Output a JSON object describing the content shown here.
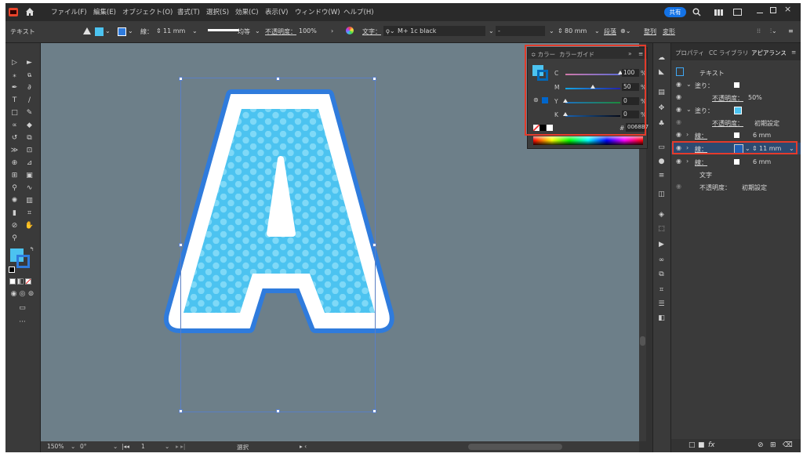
{
  "menubar": {
    "items": [
      "ファイル(F)",
      "編集(E)",
      "オブジェクト(O)",
      "書式(T)",
      "選択(S)",
      "効果(C)",
      "表示(V)",
      "ウィンドウ(W)",
      "ヘルプ(H)"
    ],
    "share_label": "共有",
    "window_controls": [
      "minimize-icon",
      "restore-icon",
      "close-icon"
    ]
  },
  "control_bar": {
    "selection_label": "テキスト",
    "stroke_label": "線：",
    "stroke_width": "11 mm",
    "stroke_profile": "均等",
    "opacity_label": "不透明度：",
    "opacity_value": "100%",
    "character_label": "文字：",
    "font_name": "M+ 1c black",
    "font_style": "-",
    "font_size": "80 mm",
    "paragraph_label": "段落",
    "align_label": "整列",
    "transform_label": "変形"
  },
  "color_panel": {
    "tabs": [
      "カラー",
      "カラーガイド"
    ],
    "channels": [
      {
        "label": "C",
        "value": "100",
        "unit": "%",
        "level": 1.0
      },
      {
        "label": "M",
        "value": "50",
        "unit": "%",
        "level": 0.5
      },
      {
        "label": "Y",
        "value": "0",
        "unit": "%",
        "level": 0.0
      },
      {
        "label": "K",
        "value": "0",
        "unit": "%",
        "level": 0.0
      }
    ],
    "hex_label": "#",
    "hex_value": "0068B7"
  },
  "appearance_panel": {
    "tabs": [
      "プロパティ",
      "CC ライブラリ",
      "アピアランス"
    ],
    "rows": [
      {
        "label": "テキスト"
      },
      {
        "label": "塗り："
      },
      {
        "label": "不透明度：",
        "value": "50%"
      },
      {
        "label": "塗り："
      },
      {
        "label": "不透明度：",
        "value": "初期設定"
      },
      {
        "label": "線：",
        "value": "6 mm"
      },
      {
        "label": "線：",
        "value": "11 mm"
      },
      {
        "label": "線：",
        "value": "6 mm"
      },
      {
        "label": "文字"
      },
      {
        "label": "不透明度：",
        "value": "初期設定"
      }
    ]
  },
  "status_bar": {
    "zoom": "150%",
    "rotation": "0°",
    "artboard_number": "1",
    "tool_name": "選択"
  },
  "colors": {
    "letter_fill": "#4cc3f0",
    "letter_dots": "#7fd9f7",
    "outer_stroke": "#2f7bdc",
    "inner_stroke": "#ffffff",
    "selected_stroke_swatch": "#0068b7",
    "canvas": "#6d7f89"
  }
}
